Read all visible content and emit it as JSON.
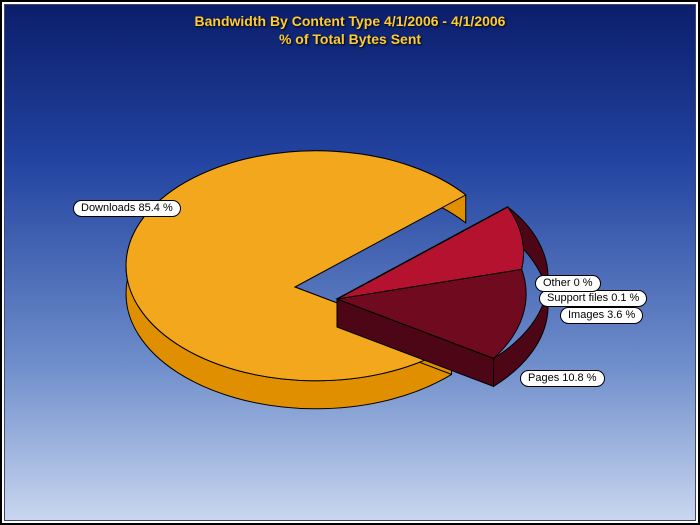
{
  "title_line1": "Bandwidth By Content Type 4/1/2006 - 4/1/2006",
  "title_line2": "% of Total Bytes Sent",
  "labels": {
    "downloads": "Downloads 85.4 %",
    "pages": "Pages 10.8 %",
    "images": "Images 3.6 %",
    "support": "Support files 0.1 %",
    "other": "Other 0 %"
  },
  "colors": {
    "downloads_fill": "#f3a71c",
    "downloads_side": "#e08f00",
    "exploded_fill": "#6f0a1f",
    "exploded_side": "#4d0616",
    "images_fill": "#b51230",
    "stroke": "#000000"
  },
  "chart_data": {
    "type": "pie",
    "title": "Bandwidth By Content Type 4/1/2006 - 4/1/2006 — % of Total Bytes Sent",
    "series": [
      {
        "name": "Downloads",
        "value": 85.4,
        "color": "#f3a71c"
      },
      {
        "name": "Pages",
        "value": 10.8,
        "color": "#6f0a1f",
        "exploded": true
      },
      {
        "name": "Images",
        "value": 3.6,
        "color": "#b51230",
        "exploded": true
      },
      {
        "name": "Support files",
        "value": 0.1,
        "color": "#8a0f28",
        "exploded": true
      },
      {
        "name": "Other",
        "value": 0.0,
        "color": "#777777",
        "exploded": true
      }
    ],
    "unit": "percent"
  }
}
